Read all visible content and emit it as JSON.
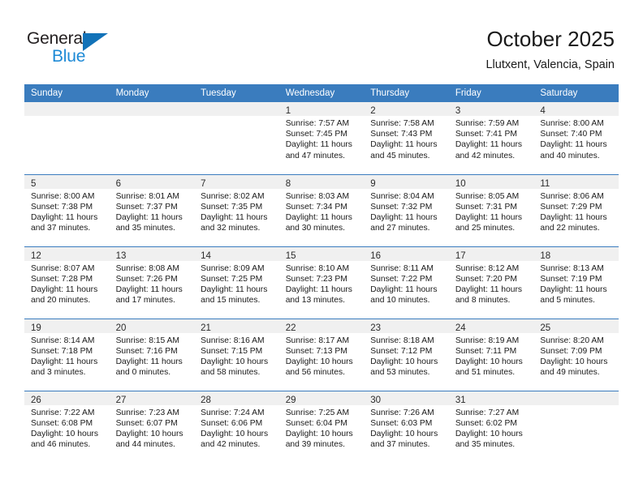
{
  "brand": {
    "name_dark": "General",
    "name_light": "Blue",
    "accent_color": "#1272b8",
    "light_accent_color": "#1e8ad6"
  },
  "header": {
    "title": "October 2025",
    "subtitle": "Llutxent, Valencia, Spain"
  },
  "calendar": {
    "header_bg": "#3a7cbe",
    "daynum_bg": "#f0f0f0",
    "weekday_headers": [
      "Sunday",
      "Monday",
      "Tuesday",
      "Wednesday",
      "Thursday",
      "Friday",
      "Saturday"
    ],
    "weeks": [
      [
        {
          "day": "",
          "empty": true
        },
        {
          "day": "",
          "empty": true
        },
        {
          "day": "",
          "empty": true
        },
        {
          "day": "1",
          "sunrise": "Sunrise: 7:57 AM",
          "sunset": "Sunset: 7:45 PM",
          "daylight1": "Daylight: 11 hours",
          "daylight2": "and 47 minutes."
        },
        {
          "day": "2",
          "sunrise": "Sunrise: 7:58 AM",
          "sunset": "Sunset: 7:43 PM",
          "daylight1": "Daylight: 11 hours",
          "daylight2": "and 45 minutes."
        },
        {
          "day": "3",
          "sunrise": "Sunrise: 7:59 AM",
          "sunset": "Sunset: 7:41 PM",
          "daylight1": "Daylight: 11 hours",
          "daylight2": "and 42 minutes."
        },
        {
          "day": "4",
          "sunrise": "Sunrise: 8:00 AM",
          "sunset": "Sunset: 7:40 PM",
          "daylight1": "Daylight: 11 hours",
          "daylight2": "and 40 minutes."
        }
      ],
      [
        {
          "day": "5",
          "sunrise": "Sunrise: 8:00 AM",
          "sunset": "Sunset: 7:38 PM",
          "daylight1": "Daylight: 11 hours",
          "daylight2": "and 37 minutes."
        },
        {
          "day": "6",
          "sunrise": "Sunrise: 8:01 AM",
          "sunset": "Sunset: 7:37 PM",
          "daylight1": "Daylight: 11 hours",
          "daylight2": "and 35 minutes."
        },
        {
          "day": "7",
          "sunrise": "Sunrise: 8:02 AM",
          "sunset": "Sunset: 7:35 PM",
          "daylight1": "Daylight: 11 hours",
          "daylight2": "and 32 minutes."
        },
        {
          "day": "8",
          "sunrise": "Sunrise: 8:03 AM",
          "sunset": "Sunset: 7:34 PM",
          "daylight1": "Daylight: 11 hours",
          "daylight2": "and 30 minutes."
        },
        {
          "day": "9",
          "sunrise": "Sunrise: 8:04 AM",
          "sunset": "Sunset: 7:32 PM",
          "daylight1": "Daylight: 11 hours",
          "daylight2": "and 27 minutes."
        },
        {
          "day": "10",
          "sunrise": "Sunrise: 8:05 AM",
          "sunset": "Sunset: 7:31 PM",
          "daylight1": "Daylight: 11 hours",
          "daylight2": "and 25 minutes."
        },
        {
          "day": "11",
          "sunrise": "Sunrise: 8:06 AM",
          "sunset": "Sunset: 7:29 PM",
          "daylight1": "Daylight: 11 hours",
          "daylight2": "and 22 minutes."
        }
      ],
      [
        {
          "day": "12",
          "sunrise": "Sunrise: 8:07 AM",
          "sunset": "Sunset: 7:28 PM",
          "daylight1": "Daylight: 11 hours",
          "daylight2": "and 20 minutes."
        },
        {
          "day": "13",
          "sunrise": "Sunrise: 8:08 AM",
          "sunset": "Sunset: 7:26 PM",
          "daylight1": "Daylight: 11 hours",
          "daylight2": "and 17 minutes."
        },
        {
          "day": "14",
          "sunrise": "Sunrise: 8:09 AM",
          "sunset": "Sunset: 7:25 PM",
          "daylight1": "Daylight: 11 hours",
          "daylight2": "and 15 minutes."
        },
        {
          "day": "15",
          "sunrise": "Sunrise: 8:10 AM",
          "sunset": "Sunset: 7:23 PM",
          "daylight1": "Daylight: 11 hours",
          "daylight2": "and 13 minutes."
        },
        {
          "day": "16",
          "sunrise": "Sunrise: 8:11 AM",
          "sunset": "Sunset: 7:22 PM",
          "daylight1": "Daylight: 11 hours",
          "daylight2": "and 10 minutes."
        },
        {
          "day": "17",
          "sunrise": "Sunrise: 8:12 AM",
          "sunset": "Sunset: 7:20 PM",
          "daylight1": "Daylight: 11 hours",
          "daylight2": "and 8 minutes."
        },
        {
          "day": "18",
          "sunrise": "Sunrise: 8:13 AM",
          "sunset": "Sunset: 7:19 PM",
          "daylight1": "Daylight: 11 hours",
          "daylight2": "and 5 minutes."
        }
      ],
      [
        {
          "day": "19",
          "sunrise": "Sunrise: 8:14 AM",
          "sunset": "Sunset: 7:18 PM",
          "daylight1": "Daylight: 11 hours",
          "daylight2": "and 3 minutes."
        },
        {
          "day": "20",
          "sunrise": "Sunrise: 8:15 AM",
          "sunset": "Sunset: 7:16 PM",
          "daylight1": "Daylight: 11 hours",
          "daylight2": "and 0 minutes."
        },
        {
          "day": "21",
          "sunrise": "Sunrise: 8:16 AM",
          "sunset": "Sunset: 7:15 PM",
          "daylight1": "Daylight: 10 hours",
          "daylight2": "and 58 minutes."
        },
        {
          "day": "22",
          "sunrise": "Sunrise: 8:17 AM",
          "sunset": "Sunset: 7:13 PM",
          "daylight1": "Daylight: 10 hours",
          "daylight2": "and 56 minutes."
        },
        {
          "day": "23",
          "sunrise": "Sunrise: 8:18 AM",
          "sunset": "Sunset: 7:12 PM",
          "daylight1": "Daylight: 10 hours",
          "daylight2": "and 53 minutes."
        },
        {
          "day": "24",
          "sunrise": "Sunrise: 8:19 AM",
          "sunset": "Sunset: 7:11 PM",
          "daylight1": "Daylight: 10 hours",
          "daylight2": "and 51 minutes."
        },
        {
          "day": "25",
          "sunrise": "Sunrise: 8:20 AM",
          "sunset": "Sunset: 7:09 PM",
          "daylight1": "Daylight: 10 hours",
          "daylight2": "and 49 minutes."
        }
      ],
      [
        {
          "day": "26",
          "sunrise": "Sunrise: 7:22 AM",
          "sunset": "Sunset: 6:08 PM",
          "daylight1": "Daylight: 10 hours",
          "daylight2": "and 46 minutes."
        },
        {
          "day": "27",
          "sunrise": "Sunrise: 7:23 AM",
          "sunset": "Sunset: 6:07 PM",
          "daylight1": "Daylight: 10 hours",
          "daylight2": "and 44 minutes."
        },
        {
          "day": "28",
          "sunrise": "Sunrise: 7:24 AM",
          "sunset": "Sunset: 6:06 PM",
          "daylight1": "Daylight: 10 hours",
          "daylight2": "and 42 minutes."
        },
        {
          "day": "29",
          "sunrise": "Sunrise: 7:25 AM",
          "sunset": "Sunset: 6:04 PM",
          "daylight1": "Daylight: 10 hours",
          "daylight2": "and 39 minutes."
        },
        {
          "day": "30",
          "sunrise": "Sunrise: 7:26 AM",
          "sunset": "Sunset: 6:03 PM",
          "daylight1": "Daylight: 10 hours",
          "daylight2": "and 37 minutes."
        },
        {
          "day": "31",
          "sunrise": "Sunrise: 7:27 AM",
          "sunset": "Sunset: 6:02 PM",
          "daylight1": "Daylight: 10 hours",
          "daylight2": "and 35 minutes."
        },
        {
          "day": "",
          "empty": true
        }
      ]
    ]
  }
}
